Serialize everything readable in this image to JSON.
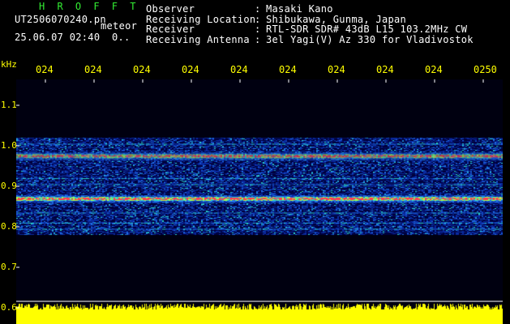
{
  "station": {
    "logo_text": "H R O F F T",
    "filename": "UT2506070240.pn",
    "mode_label": "meteor",
    "datetime": "25.06.07 02:40",
    "counter": "0..",
    "logo_color": "#33ee33"
  },
  "info": {
    "rows": [
      {
        "key": "Observer",
        "sep": ":",
        "value": "Masaki Kano"
      },
      {
        "key": "Receiving Location",
        "sep": ":",
        "value": "Shibukawa, Gunma, Japan"
      },
      {
        "key": "Receiver",
        "sep": ":",
        "value": "RTL-SDR SDR# 43dB L15 103.2MHz CW"
      },
      {
        "key": "Receiving Antenna",
        "sep": ":",
        "value": "3el Yagi(V) Az 330 for Vladivostok"
      }
    ]
  },
  "axes": {
    "y_unit": "kHz",
    "y_ticks": [
      "1.1",
      "1.0",
      "0.9",
      "0.8",
      "0.7",
      "0.6"
    ],
    "x_ticks": [
      "024",
      "024",
      "024",
      "024",
      "024",
      "024",
      "024",
      "024",
      "024",
      "0250"
    ],
    "tick_color": "#ffff00",
    "grid_color": "#ffffff"
  },
  "chart_data": {
    "type": "heatmap",
    "title": "",
    "xlabel": "",
    "ylabel": "kHz",
    "ylim": [
      0.6,
      1.15
    ],
    "y_ticks": [
      1.1,
      1.0,
      0.9,
      0.8,
      0.7,
      0.6
    ],
    "x_tick_labels": [
      "024",
      "024",
      "024",
      "024",
      "024",
      "024",
      "024",
      "024",
      "024",
      "0250"
    ],
    "signal_band_khz": [
      0.78,
      1.02
    ],
    "strong_lines_khz": [
      0.975,
      0.87
    ],
    "noise_strip_color": "#ffff00",
    "palette": [
      "#00003c",
      "#0a2aa0",
      "#1e6ee6",
      "#28d2c8",
      "#a0ff50",
      "#ff3c50"
    ]
  }
}
